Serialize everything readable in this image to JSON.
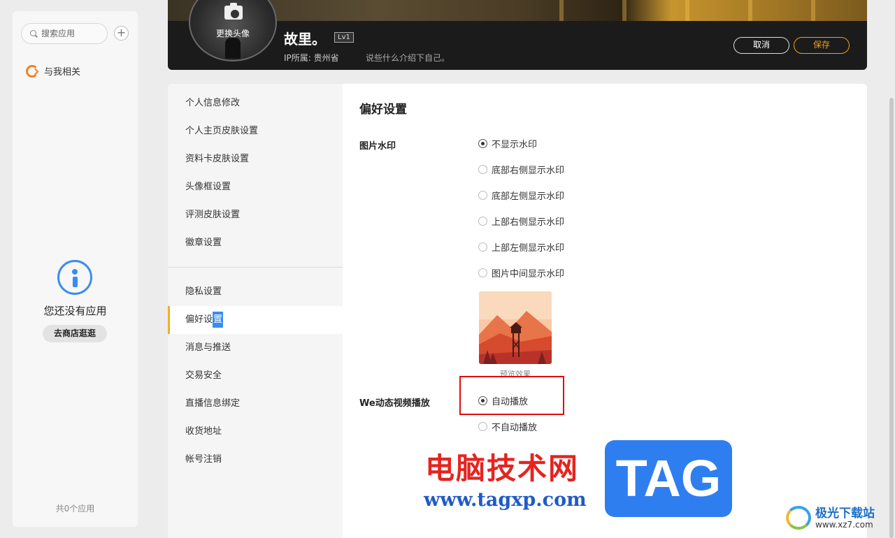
{
  "sidebar": {
    "search_placeholder": "搜索应用",
    "add_label": "+",
    "related_label": "与我相关",
    "empty_text": "您还没有应用",
    "store_button": "去商店逛逛",
    "app_count": "共0个应用"
  },
  "profile": {
    "change_avatar": "更换头像",
    "nickname": "故里。",
    "level": "Lv1",
    "ip_location": "IP所属: 贵州省",
    "intro_placeholder": "说些什么介绍下自己。",
    "cancel_label": "取消",
    "save_label": "保存"
  },
  "nav": {
    "group1": [
      "个人信息修改",
      "个人主页皮肤设置",
      "资料卡皮肤设置",
      "头像框设置",
      "评测皮肤设置",
      "徽章设置"
    ],
    "group2": [
      "隐私设置",
      "偏好设",
      "消息与推送",
      "交易安全",
      "直播信息绑定",
      "收货地址",
      "帐号注销"
    ],
    "active_selected_char": "置"
  },
  "content": {
    "title": "偏好设置",
    "watermark": {
      "label": "图片水印",
      "options": [
        "不显示水印",
        "底部右侧显示水印",
        "底部左侧显示水印",
        "上部右侧显示水印",
        "上部左侧显示水印",
        "图片中间显示水印"
      ],
      "selected_index": 0,
      "preview_caption": "预览效果"
    },
    "video": {
      "label": "We动态视频播放",
      "options": [
        "自动播放",
        "不自动播放"
      ],
      "selected_index": 0
    }
  },
  "overlay": {
    "cn_text": "电脑技术网",
    "url": "www.tagxp.com",
    "tag": "TAG",
    "site_name": "极光下载站",
    "site_domain": "www.xz7.com"
  },
  "colors": {
    "accent_save": "#f0a020",
    "nav_active_bar": "#f0b020",
    "highlight_box": "#e00d0d",
    "info_icon": "#3b8cf0"
  }
}
